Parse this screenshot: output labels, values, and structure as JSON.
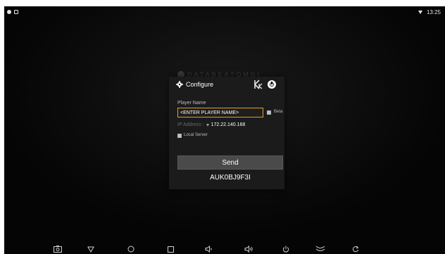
{
  "status_bar": {
    "time": "13:25"
  },
  "brand": {
    "name": "DATABEATOMNI"
  },
  "dialog": {
    "title": "Configure",
    "player_name_label": "Player Name",
    "player_name_value": "<ENTER PLAYER NAME>",
    "beta_label": "Beta",
    "ip_label": "IP Address :",
    "ip_value": "172.22.140.168",
    "local_server_label": "Local Server",
    "send_label": "Send",
    "device_code": "AUK0BJ9F3I"
  },
  "icons": {
    "nav": [
      "screenshot-icon",
      "back-icon",
      "home-icon",
      "recents-icon",
      "volume-down-icon",
      "volume-up-icon",
      "power-icon",
      "menu-icon",
      "rotate-icon"
    ]
  },
  "colors": {
    "accent": "#e0a020"
  }
}
